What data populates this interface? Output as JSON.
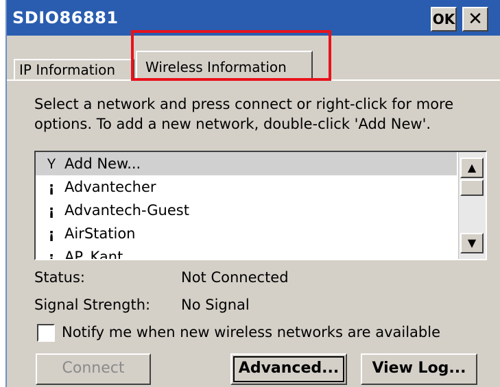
{
  "window": {
    "title": "SDIO86881",
    "ok_label": "OK",
    "close_label": "✕"
  },
  "tabs": [
    {
      "label": "IP Information"
    },
    {
      "label": "Wireless Information"
    }
  ],
  "description": "Select a network and press connect or right-click for more options.  To add a new network, double-click 'Add New'.",
  "networks": [
    {
      "label": "Add New...",
      "icon": "antenna-icon",
      "selected": true
    },
    {
      "label": "Advantecher",
      "icon": "network-icon"
    },
    {
      "label": "Advantech-Guest",
      "icon": "network-icon"
    },
    {
      "label": "AirStation",
      "icon": "network-icon"
    },
    {
      "label": "AP_Kant",
      "icon": "network-icon"
    }
  ],
  "status": {
    "label": "Status:",
    "value": "Not Connected"
  },
  "signal": {
    "label": "Signal Strength:",
    "value": "No Signal"
  },
  "notify": {
    "label": "Notify me when new wireless networks are available",
    "checked": false
  },
  "buttons": {
    "connect": "Connect",
    "advanced": "Advanced...",
    "view_log": "View Log..."
  },
  "colors": {
    "titlebar": "#2a5db0",
    "highlight": "#e8121c",
    "dialog_bg": "#d4d0c8"
  }
}
